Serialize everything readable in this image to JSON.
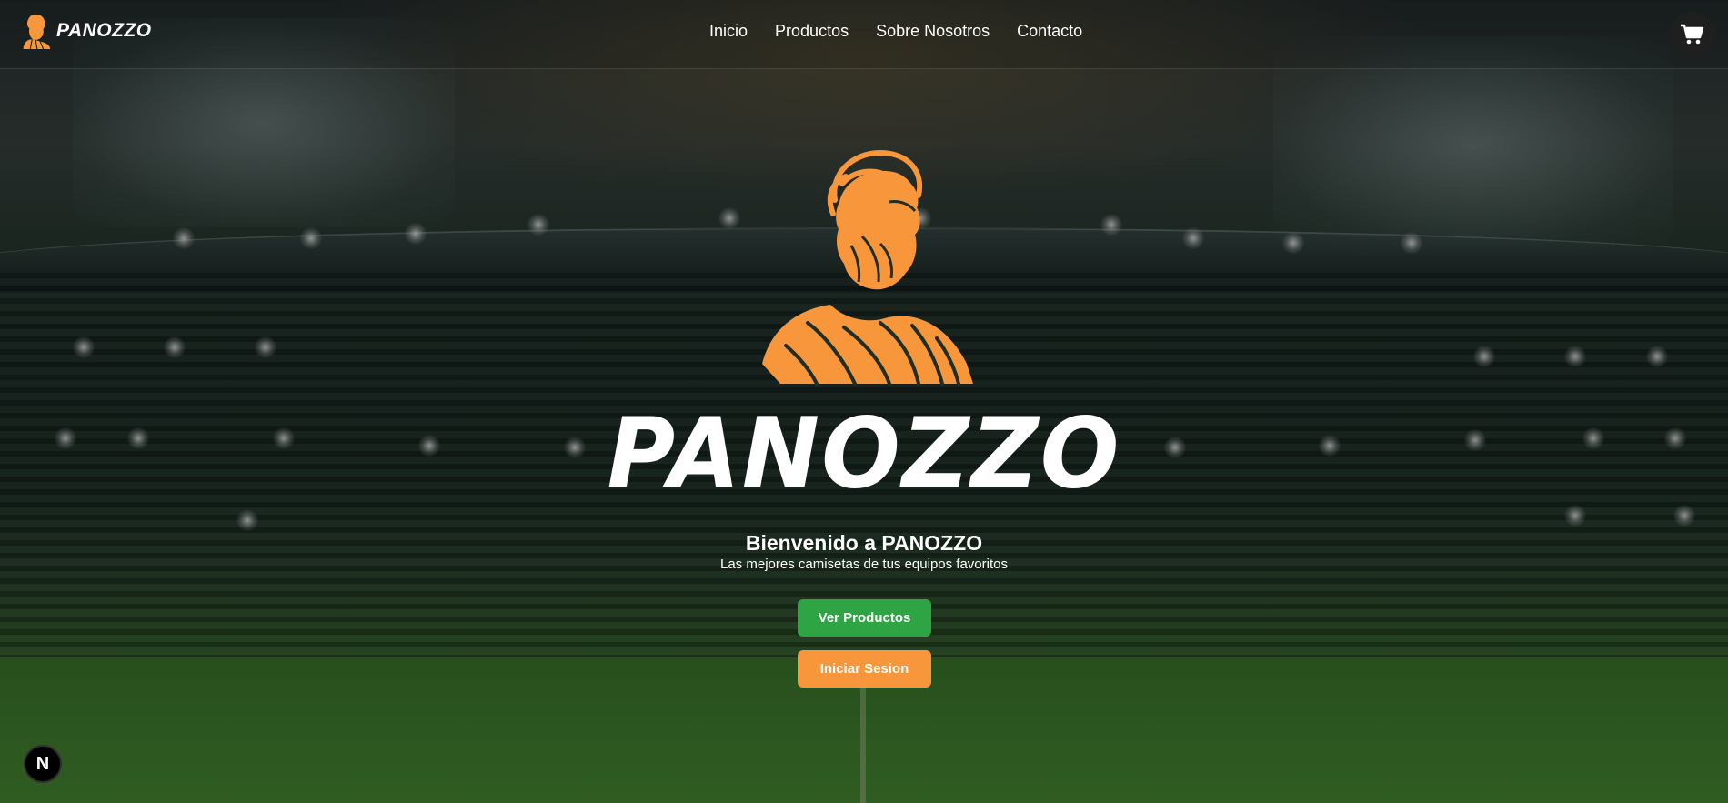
{
  "brand": {
    "name": "PANOZZO",
    "logo_icon": "bearded-bust-icon",
    "logo_color": "#f7963a"
  },
  "nav": {
    "items": [
      "Inicio",
      "Productos",
      "Sobre Nosotros",
      "Contacto"
    ]
  },
  "cart": {
    "icon": "cart-icon"
  },
  "hero": {
    "wordmark": "PANOZZO",
    "title": "Bienvenido a PANOZZO",
    "subtitle": "Las mejores camisetas de tus equipos favoritos",
    "primary_button": "Ver Productos",
    "secondary_button": "Iniciar Sesion"
  },
  "colors": {
    "green": "#2ea445",
    "orange": "#f7963a",
    "text": "#ffffff"
  },
  "dev_badge": {
    "label": "N"
  }
}
